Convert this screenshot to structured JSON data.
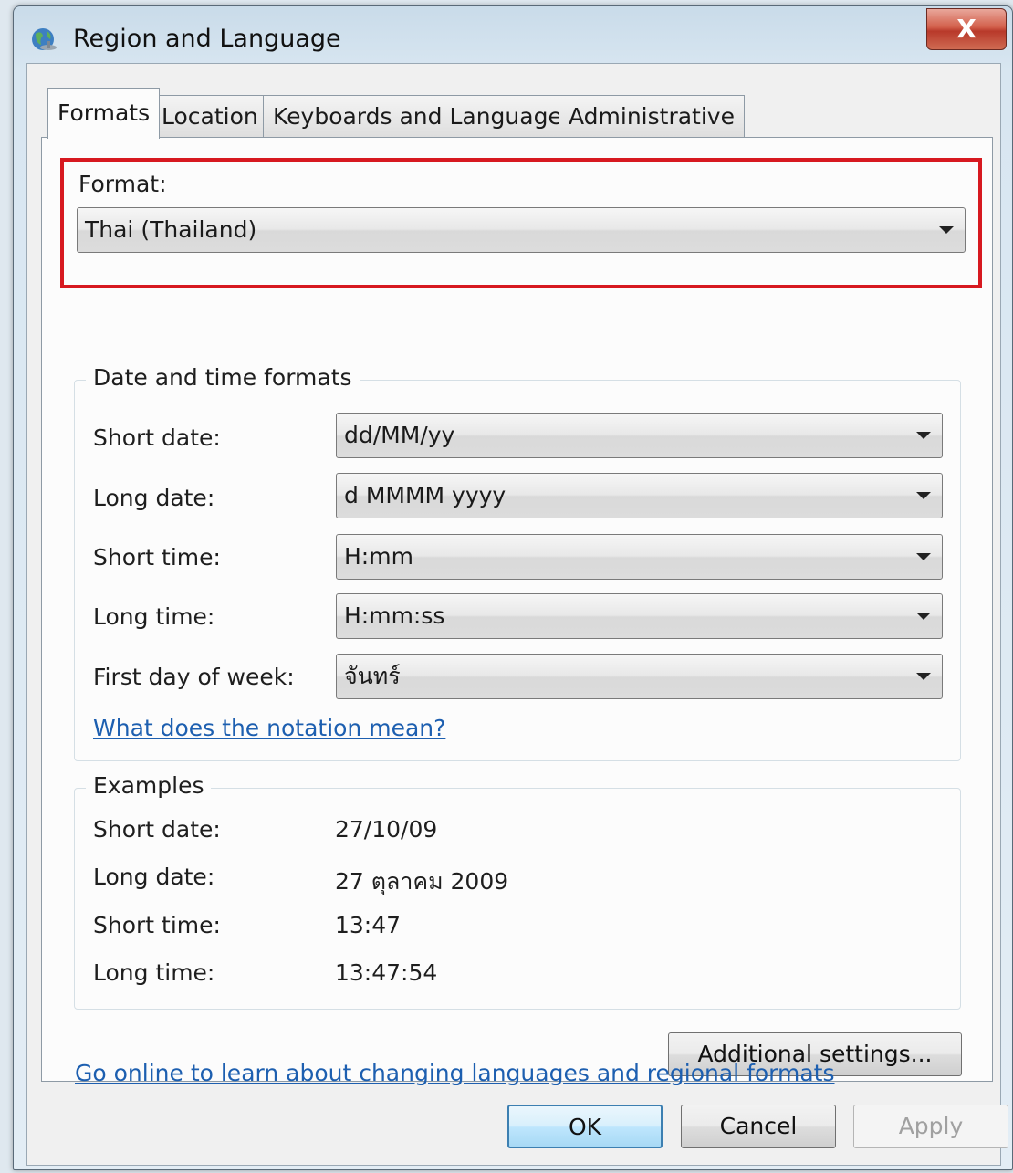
{
  "window": {
    "title": "Region and Language",
    "close_glyph": "X"
  },
  "tabs": [
    {
      "label": "Formats",
      "active": true
    },
    {
      "label": "Location",
      "active": false
    },
    {
      "label": "Keyboards and Languages",
      "active": false
    },
    {
      "label": "Administrative",
      "active": false
    }
  ],
  "format": {
    "label": "Format:",
    "value": "Thai (Thailand)"
  },
  "date_time_formats": {
    "title": "Date and time formats",
    "rows": [
      {
        "label": "Short date:",
        "value": "dd/MM/yy"
      },
      {
        "label": "Long date:",
        "value": "d MMMM yyyy"
      },
      {
        "label": "Short time:",
        "value": "H:mm"
      },
      {
        "label": "Long time:",
        "value": "H:mm:ss"
      },
      {
        "label": "First day of week:",
        "value": "จันทร์"
      }
    ],
    "notation_link": "What does the notation mean?"
  },
  "examples": {
    "title": "Examples",
    "rows": [
      {
        "label": "Short date:",
        "value": "27/10/09"
      },
      {
        "label": "Long date:",
        "value": "27 ตุลาคม 2009"
      },
      {
        "label": "Short time:",
        "value": "13:47"
      },
      {
        "label": "Long time:",
        "value": "13:47:54"
      }
    ]
  },
  "additional_settings_button": "Additional settings...",
  "online_link": "Go online to learn about changing languages and regional formats",
  "buttons": {
    "ok": "OK",
    "cancel": "Cancel",
    "apply": "Apply"
  },
  "colors": {
    "highlight_border": "#d71920",
    "link": "#1d5fb0",
    "close_button": "#c7432f"
  },
  "icons": {
    "title": "globe-icon",
    "dropdown": "chevron-down-icon"
  }
}
